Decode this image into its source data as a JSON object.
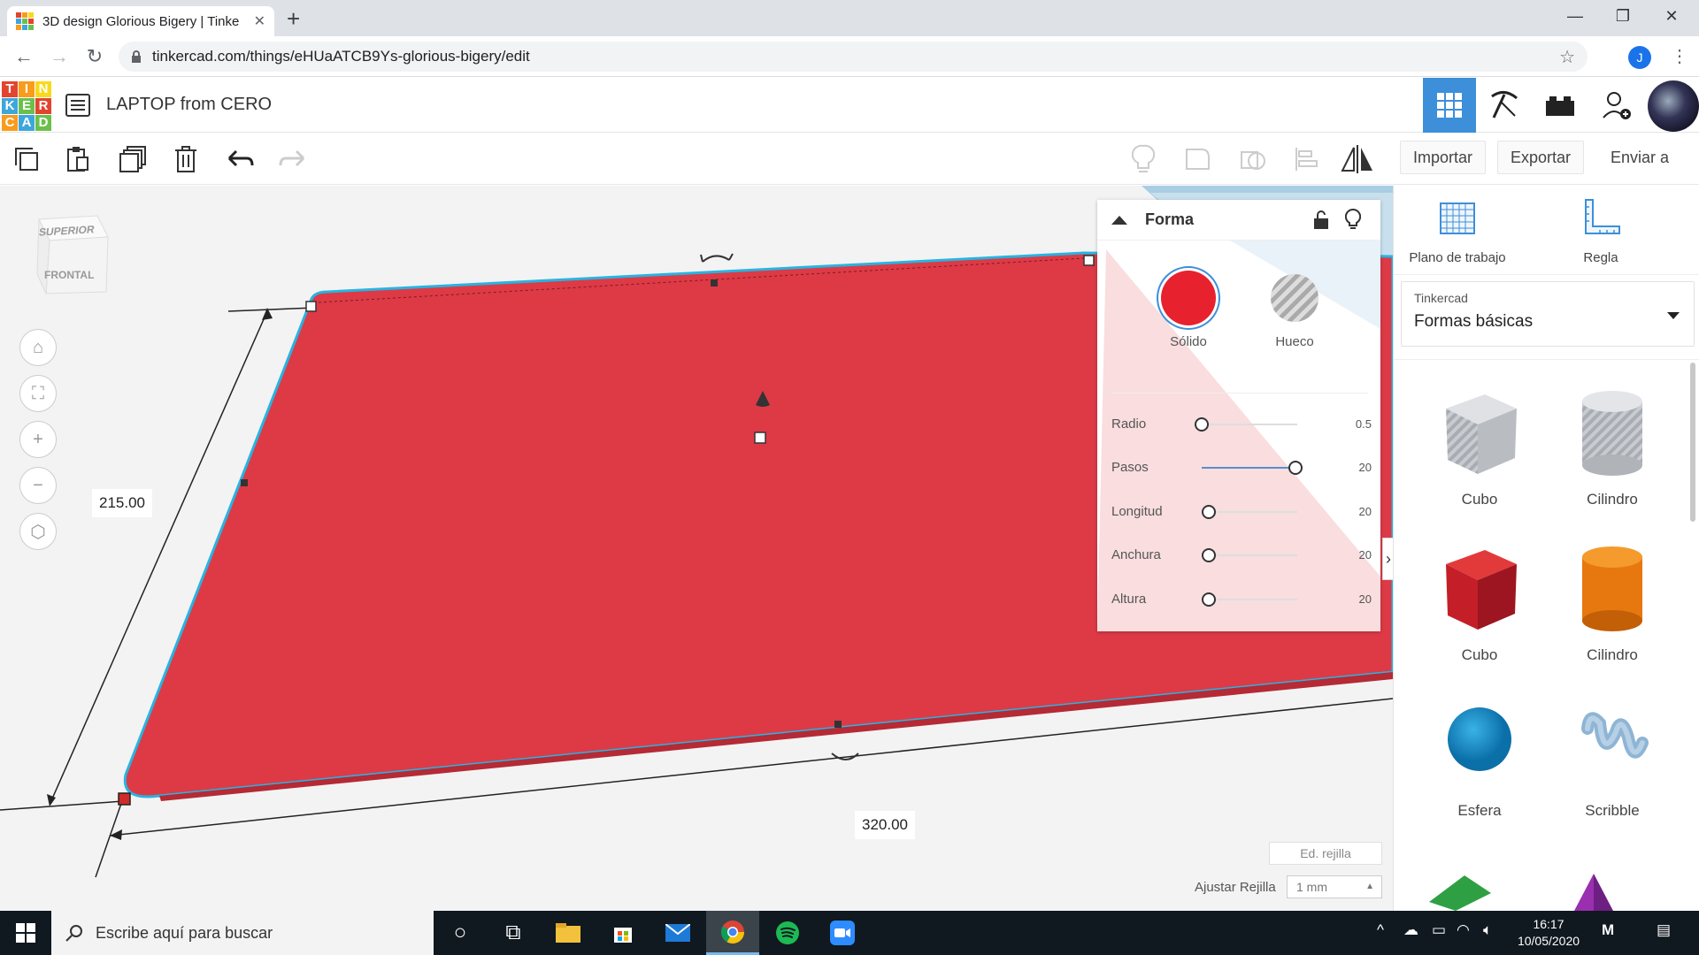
{
  "browser": {
    "tab_title": "3D design Glorious Bigery | Tinke",
    "tab_close": "✕",
    "new_tab": "+",
    "url": "tinkercad.com/things/eHUaATCB9Ys-glorious-bigery/edit",
    "profile_initial": "J"
  },
  "app": {
    "logo_letters": [
      "T",
      "I",
      "N",
      "K",
      "E",
      "R",
      "C",
      "A",
      "D"
    ],
    "logo_colors": [
      "#e2442f",
      "#f99b1c",
      "#f9d91c",
      "#3fa6db",
      "#6bc04b",
      "#e2442f",
      "#f99b1c",
      "#3fa6db",
      "#6bc04b"
    ],
    "design_title": "LAPTOP from CERO",
    "accent": "#3d8fd9"
  },
  "toolbar": {
    "import_label": "Importar",
    "export_label": "Exportar",
    "send_label": "Enviar a"
  },
  "viewcube": {
    "top": "SUPERIOR",
    "front": "FRONTAL"
  },
  "dimensions": {
    "depth": "215.00",
    "width": "320.00"
  },
  "shape": {
    "color": "#dd3a46"
  },
  "inspector": {
    "title": "Forma",
    "solid_label": "Sólido",
    "hole_label": "Hueco",
    "solid_color": "#e8212e",
    "params": [
      {
        "label": "Radio",
        "value": "0.5"
      },
      {
        "label": "Pasos",
        "value": "20"
      },
      {
        "label": "Longitud",
        "value": "20"
      },
      {
        "label": "Anchura",
        "value": "20"
      },
      {
        "label": "Altura",
        "value": "20"
      }
    ]
  },
  "right_panel": {
    "workplane_label": "Plano de trabajo",
    "ruler_label": "Regla",
    "library_source": "Tinkercad",
    "library_name": "Formas básicas",
    "shapes": [
      {
        "label": "Cubo",
        "icon": "hole-box-icon"
      },
      {
        "label": "Cilindro",
        "icon": "hole-cylinder-icon"
      },
      {
        "label": "Cubo",
        "icon": "box-icon"
      },
      {
        "label": "Cilindro",
        "icon": "cylinder-icon"
      },
      {
        "label": "Esfera",
        "icon": "sphere-icon"
      },
      {
        "label": "Scribble",
        "icon": "scribble-icon"
      }
    ]
  },
  "grid": {
    "edit_label": "Ed. rejilla",
    "snap_label": "Ajustar Rejilla",
    "snap_value": "1 mm"
  },
  "taskbar": {
    "search_placeholder": "Escribe aquí para buscar",
    "time": "16:17",
    "date": "10/05/2020"
  }
}
